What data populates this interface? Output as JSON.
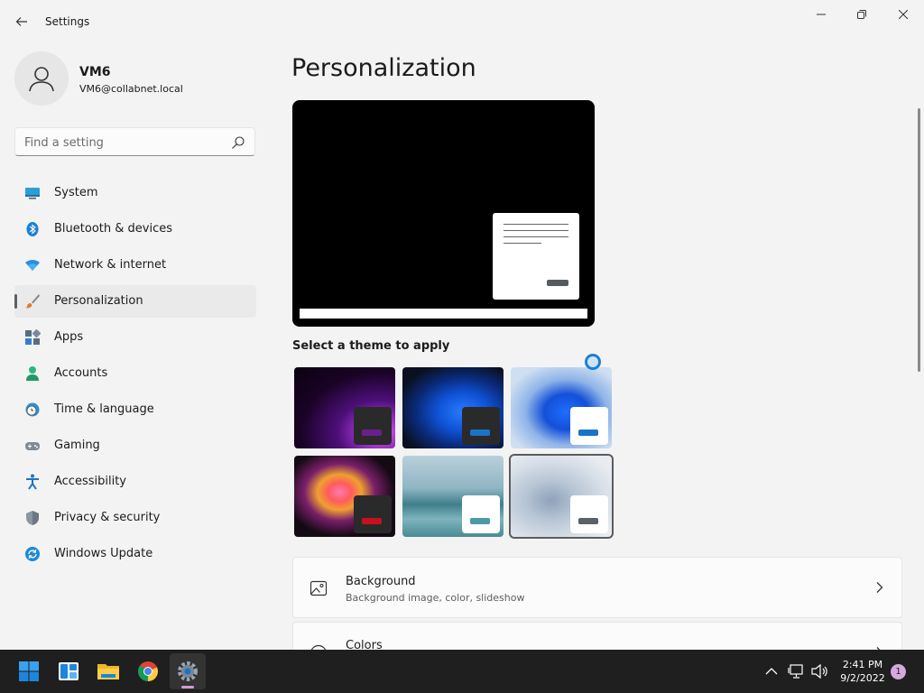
{
  "window": {
    "title": "Settings"
  },
  "user": {
    "name": "VM6",
    "email": "VM6@collabnet.local"
  },
  "search": {
    "placeholder": "Find a setting"
  },
  "sidebar": {
    "items": [
      {
        "label": "System",
        "icon": "system-icon",
        "selected": false
      },
      {
        "label": "Bluetooth & devices",
        "icon": "bluetooth-icon",
        "selected": false
      },
      {
        "label": "Network & internet",
        "icon": "wifi-icon",
        "selected": false
      },
      {
        "label": "Personalization",
        "icon": "paintbrush-icon",
        "selected": true
      },
      {
        "label": "Apps",
        "icon": "apps-icon",
        "selected": false
      },
      {
        "label": "Accounts",
        "icon": "accounts-icon",
        "selected": false
      },
      {
        "label": "Time & language",
        "icon": "clock-globe-icon",
        "selected": false
      },
      {
        "label": "Gaming",
        "icon": "gamepad-icon",
        "selected": false
      },
      {
        "label": "Accessibility",
        "icon": "accessibility-icon",
        "selected": false
      },
      {
        "label": "Privacy & security",
        "icon": "shield-icon",
        "selected": false
      },
      {
        "label": "Windows Update",
        "icon": "windows-update-icon",
        "selected": false
      }
    ]
  },
  "main": {
    "title": "Personalization",
    "themes_label": "Select a theme to apply",
    "themes": [
      {
        "name": "glow",
        "accent": "#6b1f8c",
        "selected": false
      },
      {
        "name": "windows-dark",
        "accent": "#1a73c8",
        "selected": false
      },
      {
        "name": "windows-light",
        "accent": "#1a73c8",
        "selected": false
      },
      {
        "name": "captured-motion",
        "accent": "#c8101e",
        "selected": false
      },
      {
        "name": "sunrise",
        "accent": "#4a9aa9",
        "selected": false
      },
      {
        "name": "flow",
        "accent": "#5a6268",
        "selected": true
      }
    ],
    "cards": [
      {
        "title": "Background",
        "subtitle": "Background image, color, slideshow",
        "icon": "picture-icon"
      },
      {
        "title": "Colors",
        "subtitle": "",
        "icon": "palette-icon"
      }
    ]
  },
  "taskbar": {
    "apps": [
      "start-icon",
      "widgets-icon",
      "file-explorer-icon",
      "chrome-icon",
      "settings-icon"
    ],
    "time": "2:41 PM",
    "date": "9/2/2022",
    "notifications": "1"
  },
  "colors": {
    "accent": "#0067c0",
    "background": "#f3f3f3",
    "taskbar": "#1f1f1f"
  }
}
